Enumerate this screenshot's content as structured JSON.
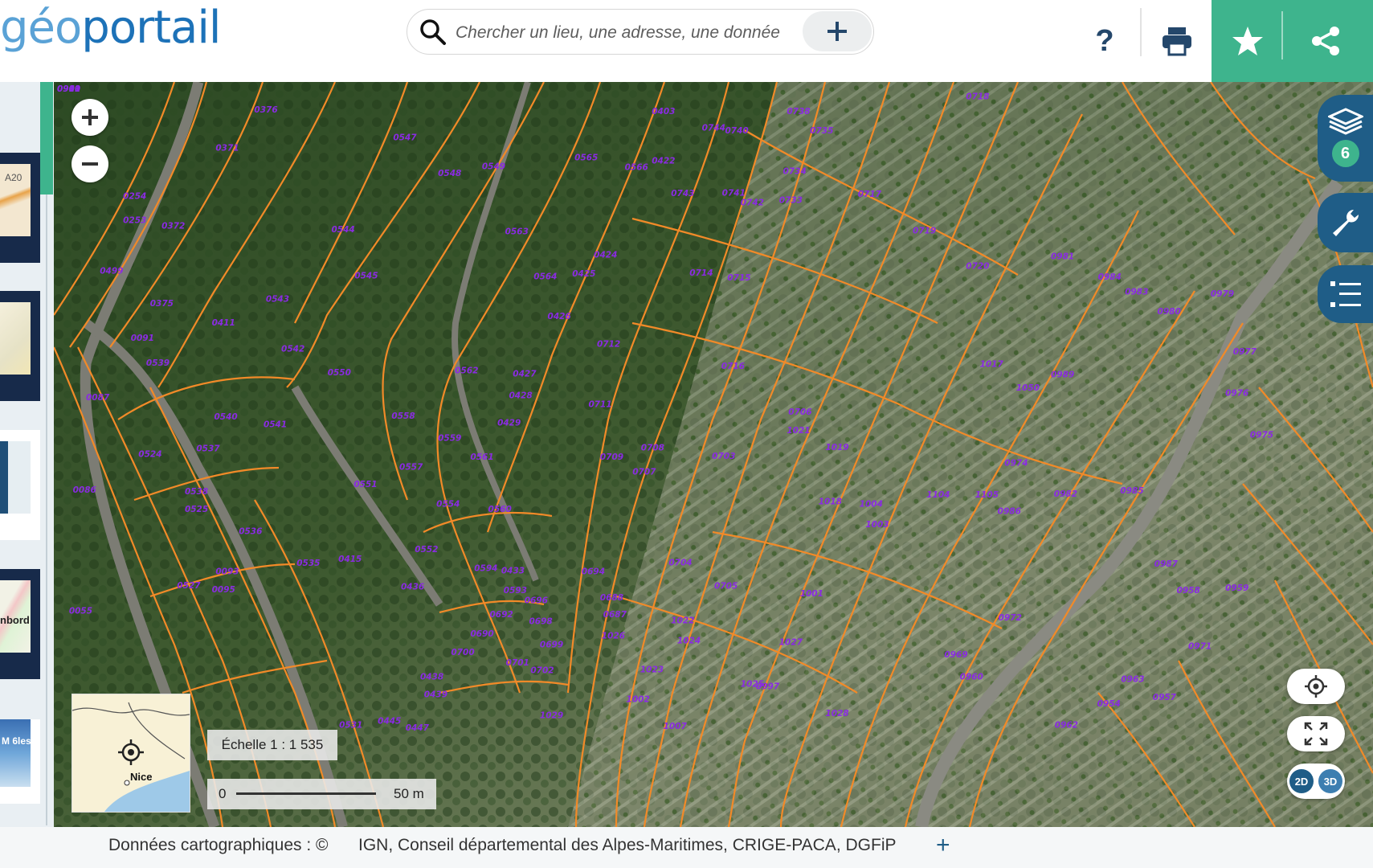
{
  "header": {
    "logo": {
      "g": "g",
      "e": "éo",
      "o": "",
      "rest": "portail"
    },
    "search": {
      "placeholder": "Chercher un lieu, une adresse, une donnée"
    },
    "help_label": "?"
  },
  "layers": {
    "count": "6"
  },
  "view": {
    "mode_2d": "2D",
    "mode_3d": "3D"
  },
  "scale": {
    "label": "Échelle 1 : 1 535",
    "start": "0",
    "end": "50 m"
  },
  "overview": {
    "place": "Nice"
  },
  "left_thumbs": [
    {
      "label": "A20"
    },
    {
      "label": ""
    },
    {
      "label": ""
    },
    {
      "label": "nbord"
    },
    {
      "label": "M 6les"
    }
  ],
  "footer": {
    "prefix": "Données cartographiques : ©",
    "credits": "IGN,  Conseil départemental des Alpes-Maritimes,  CRIGE-PACA,  DGFiP",
    "more": "+"
  },
  "map": {
    "parcel_labels": [
      "0376",
      "0371",
      "0254",
      "0253",
      "0372",
      "0499",
      "0375",
      "0091",
      "0539",
      "0087",
      "0411",
      "0543",
      "0547",
      "0548",
      "0549",
      "0544",
      "0545",
      "0542",
      "0550",
      "0540",
      "0541",
      "0537",
      "0524",
      "0086",
      "0538",
      "0525",
      "0536",
      "0535",
      "0093",
      "0095",
      "0527",
      "0055",
      "0551",
      "0557",
      "0558",
      "0559",
      "0561",
      "0554",
      "0560",
      "0552",
      "0415",
      "0436",
      "0438",
      "0439",
      "0445",
      "0447",
      "0531",
      "0565",
      "0566",
      "0563",
      "0564",
      "0425",
      "0424",
      "0426",
      "0562",
      "0427",
      "0428",
      "0429",
      "0422",
      "0403",
      "0743",
      "0744",
      "0740",
      "0738",
      "0735",
      "0734",
      "0733",
      "0741",
      "0742",
      "0717",
      "0714",
      "0715",
      "0712",
      "0711",
      "0716",
      "0719",
      "0718",
      "0720",
      "0706",
      "1021",
      "1019",
      "0709",
      "0708",
      "0707",
      "0703",
      "1018",
      "1004",
      "1003",
      "0594",
      "0433",
      "0593",
      "0696",
      "0698",
      "0694",
      "0692",
      "0690",
      "0699",
      "0700",
      "0701",
      "0702",
      "0688",
      "0687",
      "0704",
      "0705",
      "1022",
      "1026",
      "1024",
      "1023",
      "1027",
      "1025",
      "1001",
      "0997",
      "1002",
      "1007",
      "1028",
      "1029",
      "1017",
      "0989",
      "1050",
      "0981",
      "0984",
      "0983",
      "0980",
      "0979",
      "0977",
      "0976",
      "0975",
      "0974",
      "1104",
      "1105",
      "0986",
      "0982",
      "0985",
      "0987",
      "0958",
      "0959",
      "0972",
      "0971",
      "0969",
      "0960",
      "0963",
      "0954",
      "0957",
      "0962",
      "0909",
      "0910",
      "0961"
    ]
  }
}
